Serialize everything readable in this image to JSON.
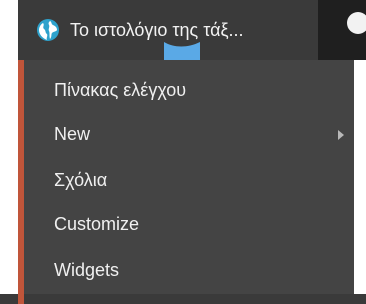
{
  "site": {
    "title": "Το ιστολόγιο της τάξ...",
    "icon": "globe-icon"
  },
  "menu": {
    "items": [
      {
        "label": "Πίνακας ελέγχου"
      },
      {
        "label": "New",
        "has_submenu": true
      },
      {
        "label": "Σχόλια"
      },
      {
        "label": "Customize"
      },
      {
        "label": "Widgets"
      }
    ]
  },
  "colors": {
    "tab_bg": "#3a3a3a",
    "menu_bg": "#444444",
    "accent": "#c0553a",
    "globe": "#2ea2cc"
  }
}
